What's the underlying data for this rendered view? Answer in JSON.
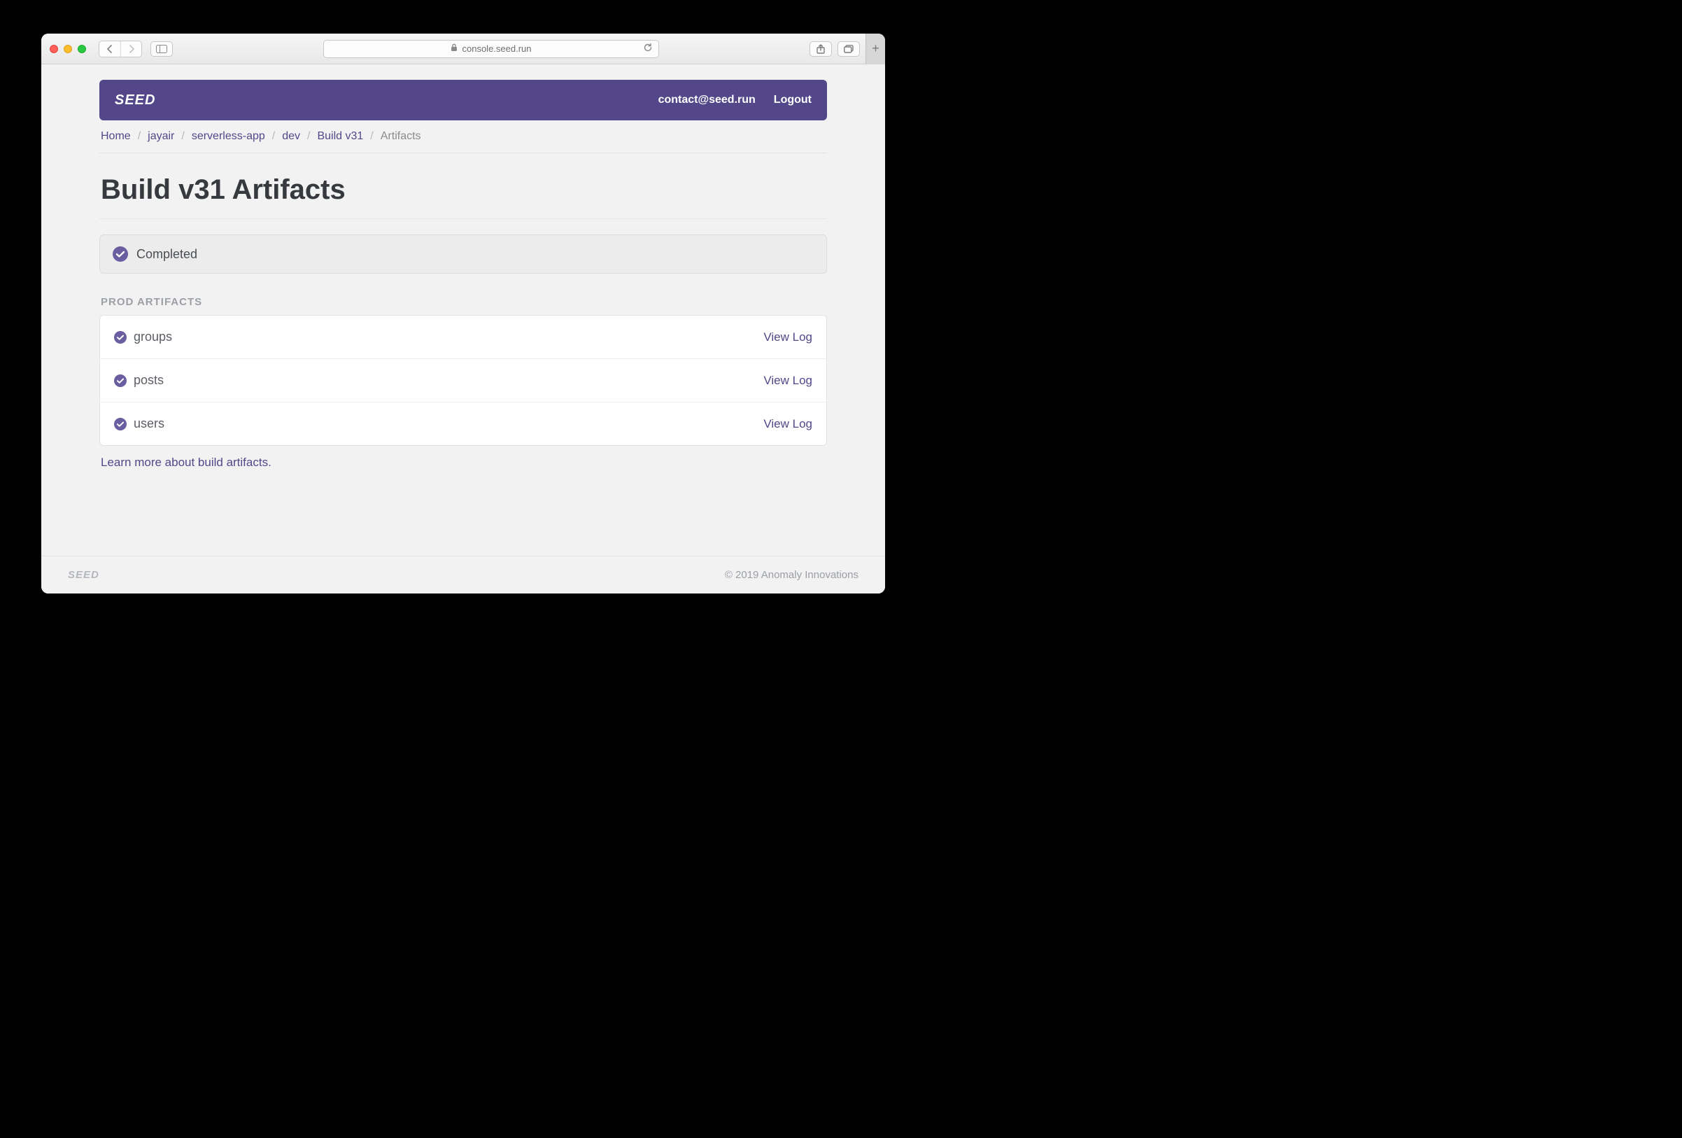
{
  "browser": {
    "url": "console.seed.run"
  },
  "topbar": {
    "brand": "SEED",
    "contact": "contact@seed.run",
    "logout": "Logout"
  },
  "breadcrumb": {
    "items": [
      {
        "label": "Home"
      },
      {
        "label": "jayair"
      },
      {
        "label": "serverless-app"
      },
      {
        "label": "dev"
      },
      {
        "label": "Build v31"
      }
    ],
    "current": "Artifacts"
  },
  "page": {
    "title": "Build v31 Artifacts",
    "status": "Completed",
    "section_label": "PROD ARTIFACTS",
    "learn_more": "Learn more about build artifacts."
  },
  "artifacts": [
    {
      "name": "groups",
      "action": "View Log"
    },
    {
      "name": "posts",
      "action": "View Log"
    },
    {
      "name": "users",
      "action": "View Log"
    }
  ],
  "footer": {
    "brand": "SEED",
    "copyright": "© 2019 Anomaly Innovations"
  },
  "colors": {
    "accent": "#53478a"
  }
}
